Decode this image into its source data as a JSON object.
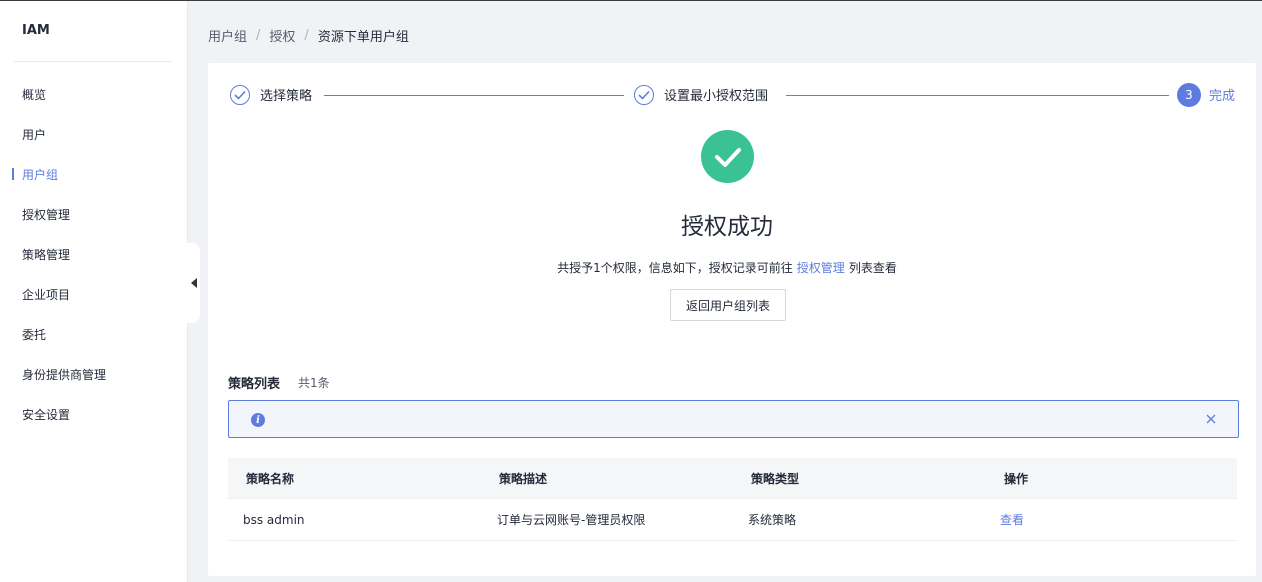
{
  "sidebar": {
    "brand": "IAM",
    "items": [
      {
        "label": "概览"
      },
      {
        "label": "用户"
      },
      {
        "label": "用户组"
      },
      {
        "label": "授权管理"
      },
      {
        "label": "策略管理"
      },
      {
        "label": "企业项目"
      },
      {
        "label": "委托"
      },
      {
        "label": "身份提供商管理"
      },
      {
        "label": "安全设置"
      }
    ],
    "active_item": "用户组"
  },
  "breadcrumb": {
    "items": [
      "用户组",
      "授权",
      "资源下单用户组"
    ],
    "separator": "/"
  },
  "steps": [
    {
      "label": "选择策略",
      "status": "done"
    },
    {
      "label": "设置最小授权范围",
      "status": "done"
    },
    {
      "label": "完成",
      "number": "3",
      "status": "current"
    }
  ],
  "result": {
    "title": "授权成功",
    "desc_prefix": "共授予1个权限，信息如下，授权记录可前往",
    "desc_link": "授权管理",
    "desc_suffix": "列表查看",
    "back_button": "返回用户组列表"
  },
  "policy_list": {
    "title": "策略列表",
    "count": "共1条",
    "columns": [
      "策略名称",
      "策略描述",
      "策略类型",
      "操作"
    ],
    "rows": [
      {
        "name": "bss admin",
        "description": "订单与云网账号-管理员权限",
        "type": "系统策略",
        "action": "查看"
      }
    ]
  },
  "colors": {
    "accent": "#5e7ce0",
    "success": "#3ac295",
    "background": "#f0f2f5"
  }
}
